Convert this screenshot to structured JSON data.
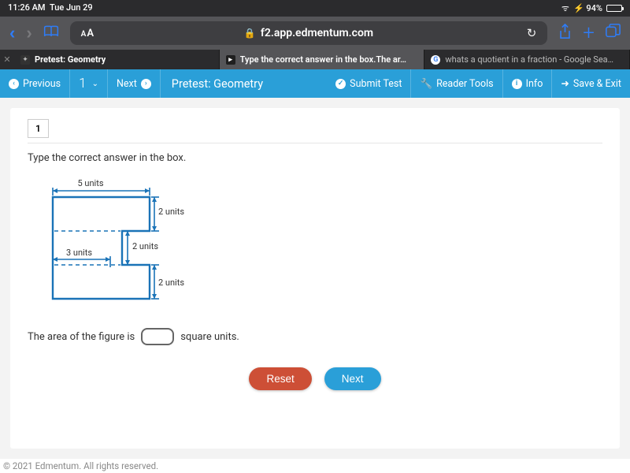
{
  "status": {
    "time": "11:26 AM",
    "date": "Tue Jun 29",
    "battery": "94%"
  },
  "browser": {
    "url": "f2.app.edmentum.com",
    "tabs": {
      "t1": "Pretest: Geometry",
      "t2": "Type the correct answer in the box.The ar…",
      "t3": "whats a quotient in a fraction - Google Sea…"
    }
  },
  "toolbar": {
    "previous": "Previous",
    "qnum": "1",
    "next": "Next",
    "title": "Pretest: Geometry",
    "submit": "Submit Test",
    "reader": "Reader Tools",
    "info": "Info",
    "save_exit": "Save & Exit"
  },
  "question": {
    "number": "1",
    "instruction": "Type the correct answer in the box.",
    "prompt_left": "The area of the figure is",
    "prompt_right": "square units.",
    "dims": {
      "topw": "5 units",
      "righth1": "2 units",
      "midw": "3 units",
      "midh": "2 units",
      "righth2": "2 units"
    },
    "buttons": {
      "reset": "Reset",
      "next": "Next"
    }
  },
  "footer": "© 2021 Edmentum. All rights reserved."
}
